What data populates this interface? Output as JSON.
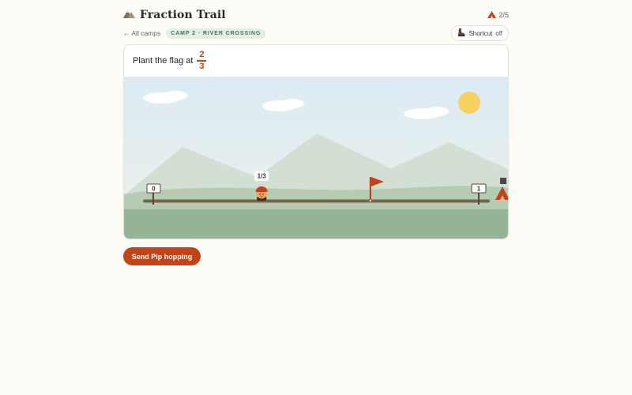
{
  "app": {
    "title": "Fraction Trail",
    "logo_icon": "mountain-icon"
  },
  "progress": {
    "text": "2/5",
    "icon": "tent-icon"
  },
  "nav": {
    "back_label": "← All camps"
  },
  "camp": {
    "badge": "CAMP 2 · RIVER CROSSING"
  },
  "shortcut": {
    "label": "Shortcut",
    "state": "off",
    "icon": "hiking-boot-icon"
  },
  "prompt": {
    "text": "Plant the flag at",
    "numerator": "2",
    "denominator": "3"
  },
  "scene": {
    "start_label": "0",
    "end_label": "1",
    "pip_position_label": "1/3",
    "pip_position": 0.333,
    "flag_position": 0.667
  },
  "colors": {
    "accent": "#c0431a",
    "badge_bg": "#e3efe4",
    "badge_text": "#3c7a52",
    "sky": "#e3eef4",
    "meadow": "#93b595"
  },
  "actions": {
    "hop_label": "Send Pip hopping"
  }
}
